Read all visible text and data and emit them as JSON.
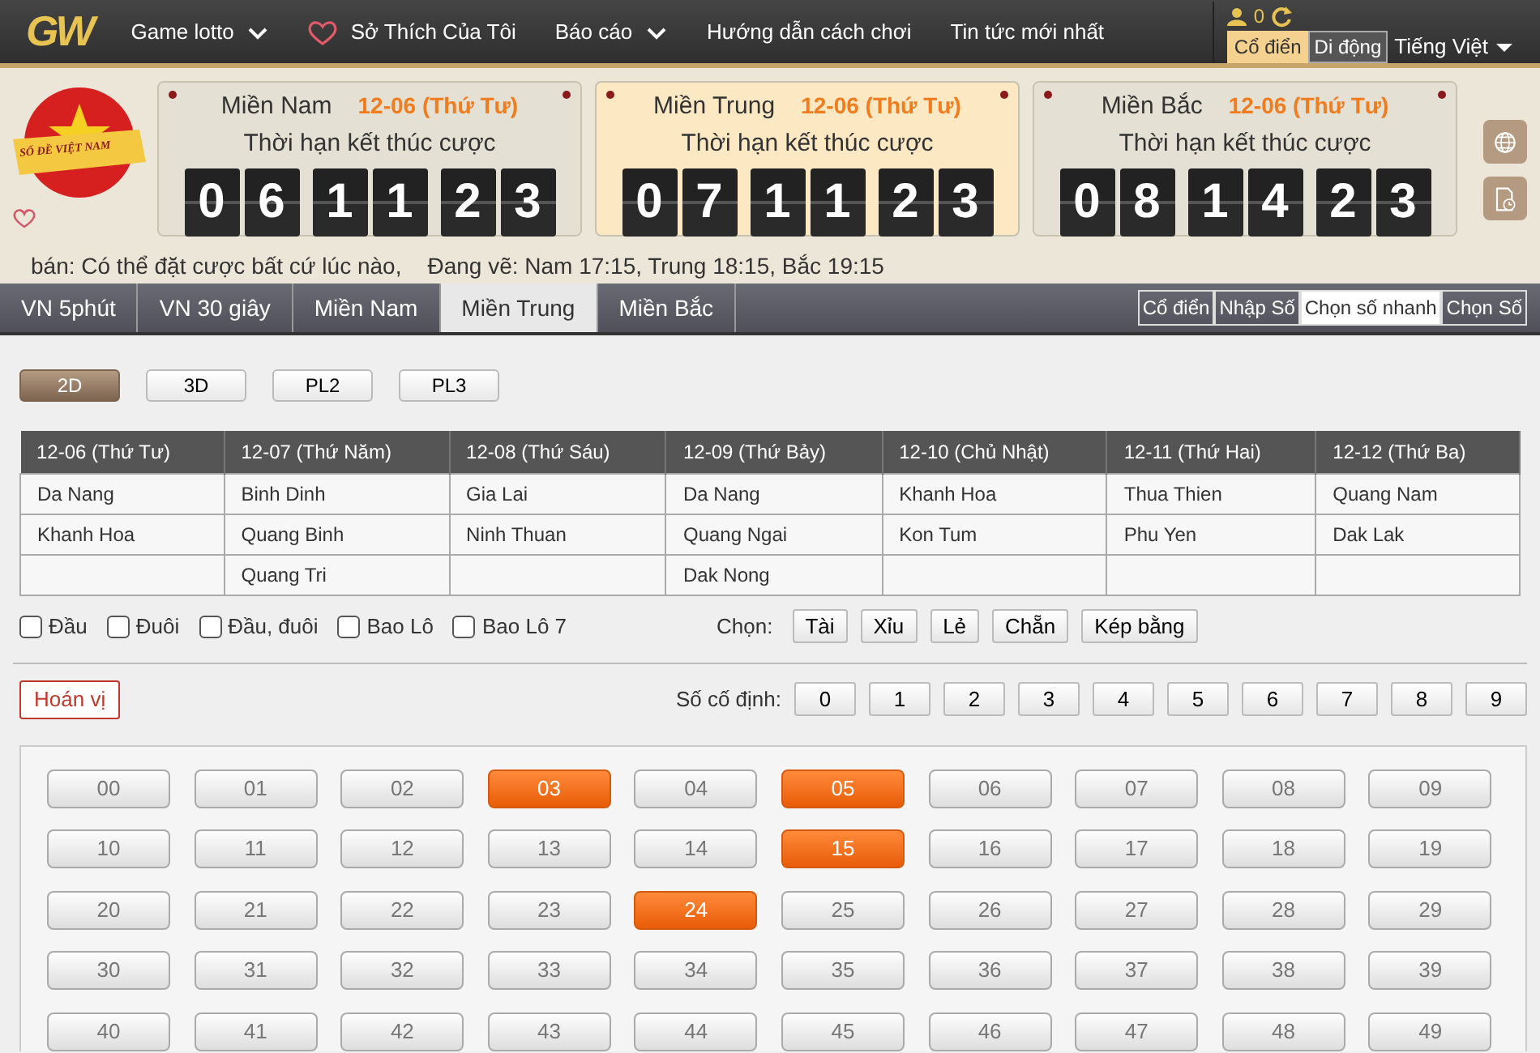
{
  "nav": {
    "logo": "GW",
    "items": [
      {
        "label": "Game lotto",
        "kind": "dropdown"
      },
      {
        "label": "Sở Thích Của Tôi",
        "kind": "heart"
      },
      {
        "label": "Báo cáo",
        "kind": "dropdown"
      },
      {
        "label": "Hướng dẫn cách chơi",
        "kind": "plain"
      },
      {
        "label": "Tin tức mới nhất",
        "kind": "plain"
      }
    ],
    "user_count": "0",
    "view_modes": [
      {
        "label": "Cổ điển",
        "selected": true
      },
      {
        "label": "Di động",
        "selected": false
      }
    ],
    "language": "Tiếng Việt"
  },
  "badge_text": "SỐ ĐỀ VIỆT NAM",
  "regions": [
    {
      "name": "Miền Nam",
      "date": "12-06 (Thứ Tư)",
      "subtitle": "Thời hạn kết thúc cược",
      "digits": [
        "0",
        "6",
        "1",
        "1",
        "2",
        "3"
      ],
      "selected": false
    },
    {
      "name": "Miền Trung",
      "date": "12-06 (Thứ Tư)",
      "subtitle": "Thời hạn kết thúc cược",
      "digits": [
        "0",
        "7",
        "1",
        "1",
        "2",
        "3"
      ],
      "selected": true
    },
    {
      "name": "Miền Bắc",
      "date": "12-06 (Thứ Tư)",
      "subtitle": "Thời hạn kết thúc cược",
      "digits": [
        "0",
        "8",
        "1",
        "4",
        "2",
        "3"
      ],
      "selected": false
    }
  ],
  "info": [
    "bán: Có thể đặt cược bất cứ lúc nào,",
    "Đang vẽ: Nam 17:15, Trung 18:15, Bắc 19:15"
  ],
  "tabs": [
    {
      "label": "VN 5phút",
      "selected": false
    },
    {
      "label": "VN 30 giây",
      "selected": false
    },
    {
      "label": "Miền Nam",
      "selected": false
    },
    {
      "label": "Miền Trung",
      "selected": true
    },
    {
      "label": "Miền Bắc",
      "selected": false
    }
  ],
  "modes": [
    {
      "label": "Cổ điển",
      "selected": false
    },
    {
      "label": "Nhập Số",
      "selected": false
    },
    {
      "label": "Chọn số nhanh",
      "selected": true
    },
    {
      "label": "Chọn Số",
      "selected": false
    }
  ],
  "game_types": [
    {
      "label": "2D",
      "selected": true
    },
    {
      "label": "3D",
      "selected": false
    },
    {
      "label": "PL2",
      "selected": false
    },
    {
      "label": "PL3",
      "selected": false
    }
  ],
  "schedule": {
    "columns": [
      "12-06 (Thứ Tư)",
      "12-07 (Thứ Năm)",
      "12-08 (Thứ Sáu)",
      "12-09 (Thứ Bảy)",
      "12-10 (Chủ Nhật)",
      "12-11 (Thứ Hai)",
      "12-12 (Thứ Ba)"
    ],
    "rows": [
      [
        "Da Nang",
        "Binh Dinh",
        "Gia Lai",
        "Da Nang",
        "Khanh Hoa",
        "Thua Thien",
        "Quang Nam"
      ],
      [
        "Khanh Hoa",
        "Quang Binh",
        "Ninh Thuan",
        "Quang Ngai",
        "Kon Tum",
        "Phu Yen",
        "Dak Lak"
      ],
      [
        "",
        "Quang Tri",
        "",
        "Dak Nong",
        "",
        "",
        ""
      ]
    ]
  },
  "options": [
    {
      "label": "Đầu",
      "checked": false
    },
    {
      "label": "Đuôi",
      "checked": false
    },
    {
      "label": "Đầu, đuôi",
      "checked": false
    },
    {
      "label": "Bao Lô",
      "checked": false
    },
    {
      "label": "Bao Lô 7",
      "checked": false
    }
  ],
  "choose_label": "Chọn:",
  "choose_buttons": [
    "Tài",
    "Xỉu",
    "Lẻ",
    "Chẵn",
    "Kép bằng"
  ],
  "permute_button": "Hoán vị",
  "fixed_label": "Số cố định:",
  "fixed_digits": [
    "0",
    "1",
    "2",
    "3",
    "4",
    "5",
    "6",
    "7",
    "8",
    "9"
  ],
  "numbers": [
    {
      "label": "00",
      "selected": false
    },
    {
      "label": "01",
      "selected": false
    },
    {
      "label": "02",
      "selected": false
    },
    {
      "label": "03",
      "selected": true
    },
    {
      "label": "04",
      "selected": false
    },
    {
      "label": "05",
      "selected": true
    },
    {
      "label": "06",
      "selected": false
    },
    {
      "label": "07",
      "selected": false
    },
    {
      "label": "08",
      "selected": false
    },
    {
      "label": "09",
      "selected": false
    },
    {
      "label": "10",
      "selected": false
    },
    {
      "label": "11",
      "selected": false
    },
    {
      "label": "12",
      "selected": false
    },
    {
      "label": "13",
      "selected": false
    },
    {
      "label": "14",
      "selected": false
    },
    {
      "label": "15",
      "selected": true
    },
    {
      "label": "16",
      "selected": false
    },
    {
      "label": "17",
      "selected": false
    },
    {
      "label": "18",
      "selected": false
    },
    {
      "label": "19",
      "selected": false
    },
    {
      "label": "20",
      "selected": false
    },
    {
      "label": "21",
      "selected": false
    },
    {
      "label": "22",
      "selected": false
    },
    {
      "label": "23",
      "selected": false
    },
    {
      "label": "24",
      "selected": true
    },
    {
      "label": "25",
      "selected": false
    },
    {
      "label": "26",
      "selected": false
    },
    {
      "label": "27",
      "selected": false
    },
    {
      "label": "28",
      "selected": false
    },
    {
      "label": "29",
      "selected": false
    },
    {
      "label": "30",
      "selected": false
    },
    {
      "label": "31",
      "selected": false
    },
    {
      "label": "32",
      "selected": false
    },
    {
      "label": "33",
      "selected": false
    },
    {
      "label": "34",
      "selected": false
    },
    {
      "label": "35",
      "selected": false
    },
    {
      "label": "36",
      "selected": false
    },
    {
      "label": "37",
      "selected": false
    },
    {
      "label": "38",
      "selected": false
    },
    {
      "label": "39",
      "selected": false
    },
    {
      "label": "40",
      "selected": false
    },
    {
      "label": "41",
      "selected": false
    },
    {
      "label": "42",
      "selected": false
    },
    {
      "label": "43",
      "selected": false
    },
    {
      "label": "44",
      "selected": false
    },
    {
      "label": "45",
      "selected": false
    },
    {
      "label": "46",
      "selected": false
    },
    {
      "label": "47",
      "selected": false
    },
    {
      "label": "48",
      "selected": false
    },
    {
      "label": "49",
      "selected": false
    }
  ]
}
